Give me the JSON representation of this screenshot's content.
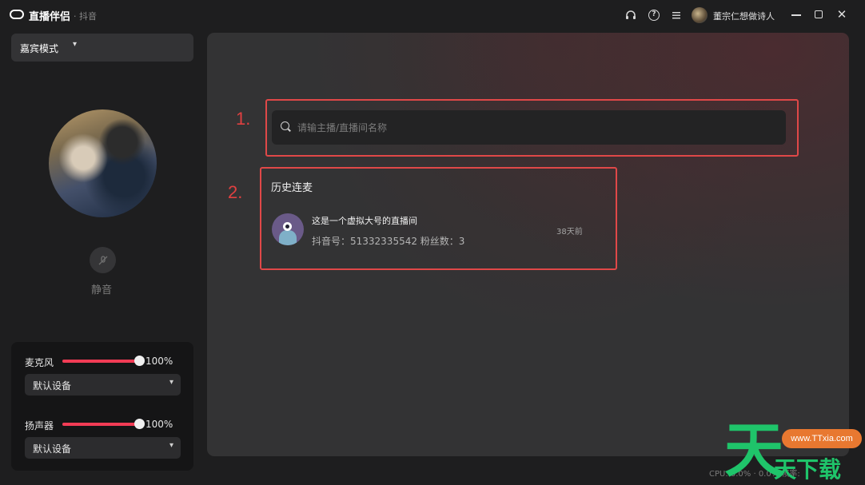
{
  "titlebar": {
    "app_name": "直播伴侣",
    "app_sub": "· 抖音",
    "user_name": "董宗仁想做诗人",
    "help_icon": "?",
    "close_icon": "✕"
  },
  "sidebar": {
    "mode_label": "嘉宾模式",
    "mute_label": "静音"
  },
  "audio": {
    "mic": {
      "label": "麦克风",
      "level": 100,
      "level_text": "100%",
      "device": "默认设备"
    },
    "speaker": {
      "label": "扬声器",
      "level": 100,
      "level_text": "100%",
      "device": "默认设备"
    }
  },
  "main": {
    "annotation_1": "1.",
    "annotation_2": "2.",
    "search_placeholder": "请输主播/直播间名称",
    "history_title": "历史连麦",
    "history": [
      {
        "name": "这是一个虚拟大号的直播间",
        "meta": "抖音号：51332335542 粉丝数：3",
        "time": "38天前"
      }
    ]
  },
  "footer": {
    "stats": "CPU: 0.0%   ·   0.0%   帧率:"
  },
  "watermark": {
    "big": "天",
    "small": "天下载",
    "url": "www.TTxia.com"
  },
  "colors": {
    "accent": "#f23c55",
    "annotation": "#e04848",
    "watermark_green": "#1fc46a"
  }
}
